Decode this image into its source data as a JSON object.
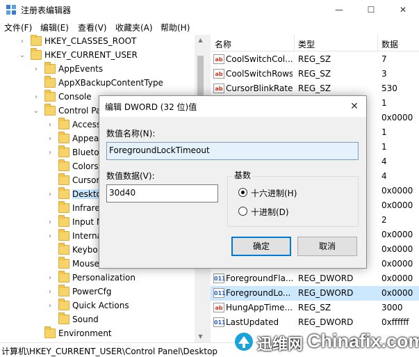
{
  "window": {
    "title": "注册表编辑器",
    "controls": {
      "minimize": "—",
      "maximize": "☐",
      "close": "✕"
    }
  },
  "menu": [
    "文件(F)",
    "编辑(E)",
    "查看(V)",
    "收藏夹(A)",
    "帮助(H)"
  ],
  "tree": [
    {
      "label": "HKEY_CLASSES_ROOT",
      "level": 0,
      "expander": "›"
    },
    {
      "label": "HKEY_CURRENT_USER",
      "level": 0,
      "expander": "⌄"
    },
    {
      "label": "AppEvents",
      "level": 1,
      "expander": "›"
    },
    {
      "label": "AppXBackupContentType",
      "level": 1,
      "expander": ""
    },
    {
      "label": "Console",
      "level": 1,
      "expander": "›"
    },
    {
      "label": "Control Pa",
      "level": 1,
      "expander": "⌄"
    },
    {
      "label": "Access",
      "level": 2,
      "expander": "›"
    },
    {
      "label": "Appea",
      "level": 2,
      "expander": "›"
    },
    {
      "label": "Blueto",
      "level": 2,
      "expander": "›"
    },
    {
      "label": "Colors",
      "level": 2,
      "expander": ""
    },
    {
      "label": "Cursor",
      "level": 2,
      "expander": ""
    },
    {
      "label": "Deskto",
      "level": 2,
      "expander": "›",
      "selected": true
    },
    {
      "label": "Infrare",
      "level": 2,
      "expander": ""
    },
    {
      "label": "Input M",
      "level": 2,
      "expander": "›"
    },
    {
      "label": "Interna",
      "level": 2,
      "expander": "›"
    },
    {
      "label": "Keybo",
      "level": 2,
      "expander": ""
    },
    {
      "label": "Mouse",
      "level": 2,
      "expander": ""
    },
    {
      "label": "Personalization",
      "level": 2,
      "expander": "›"
    },
    {
      "label": "PowerCfg",
      "level": 2,
      "expander": "›"
    },
    {
      "label": "Quick Actions",
      "level": 2,
      "expander": "›"
    },
    {
      "label": "Sound",
      "level": 2,
      "expander": ""
    },
    {
      "label": "Environment",
      "level": 1,
      "expander": ""
    }
  ],
  "list": {
    "columns": [
      "名称",
      "类型",
      "数据"
    ],
    "rows": [
      {
        "icon": "ab",
        "kind": "sz",
        "name": "CoolSwitchCol...",
        "type": "REG_SZ",
        "data": "7"
      },
      {
        "icon": "ab",
        "kind": "sz",
        "name": "CoolSwitchRows",
        "type": "REG_SZ",
        "data": "3"
      },
      {
        "icon": "ab",
        "kind": "sz",
        "name": "CursorBlinkRate",
        "type": "REG_SZ",
        "data": "530"
      },
      {
        "icon": "",
        "kind": "",
        "name": "",
        "type": "",
        "data": "1"
      },
      {
        "icon": "",
        "kind": "",
        "name": "",
        "type": "",
        "data": "0x0000"
      },
      {
        "icon": "",
        "kind": "",
        "name": "",
        "type": "",
        "data": "1"
      },
      {
        "icon": "",
        "kind": "",
        "name": "",
        "type": "",
        "data": "1"
      },
      {
        "icon": "",
        "kind": "",
        "name": "",
        "type": "",
        "data": "4"
      },
      {
        "icon": "",
        "kind": "",
        "name": "",
        "type": "",
        "data": "4"
      },
      {
        "icon": "",
        "kind": "",
        "name": "",
        "type": "",
        "data": "0x0000"
      },
      {
        "icon": "",
        "kind": "",
        "name": "",
        "type": "",
        "data": "0x0000"
      },
      {
        "icon": "",
        "kind": "",
        "name": "",
        "type": "",
        "data": "2"
      },
      {
        "icon": "",
        "kind": "",
        "name": "",
        "type": "",
        "data": "0x0000"
      },
      {
        "icon": "",
        "kind": "",
        "name": "",
        "type": "",
        "data": "0x0000"
      },
      {
        "icon": "",
        "kind": "",
        "name": "",
        "type": "",
        "data": "0x0000"
      },
      {
        "icon": "011",
        "kind": "dw",
        "name": "ForegroundFla...",
        "type": "REG_DWORD",
        "data": "0x0000"
      },
      {
        "icon": "011",
        "kind": "dw",
        "name": "ForegroundLo...",
        "type": "REG_DWORD",
        "data": "0x0000",
        "selected": true
      },
      {
        "icon": "ab",
        "kind": "sz",
        "name": "HungAppTime...",
        "type": "REG_SZ",
        "data": "3000"
      },
      {
        "icon": "011",
        "kind": "dw",
        "name": "LastUpdated",
        "type": "REG_DWORD",
        "data": "0xffffff"
      }
    ]
  },
  "status": {
    "path": "计算机\\HKEY_CURRENT_USER\\Control Panel\\Desktop"
  },
  "watermark": {
    "cn": "迅维网",
    "en": "Chinafix.com"
  },
  "dialog": {
    "title": "编辑 DWORD (32 位)值",
    "close": "✕",
    "name_label": "数值名称(N):",
    "name_value": "ForegroundLockTimeout",
    "data_label": "数值数据(V):",
    "data_value": "30d40",
    "base_label": "基数",
    "radio_hex": "十六进制(H)",
    "radio_dec": "十进制(D)",
    "selected_base": "hex",
    "ok": "确定",
    "cancel": "取消"
  },
  "colors": {
    "selection": "#cce8ff",
    "accent": "#0078d7",
    "folder": "#f7d46b"
  }
}
